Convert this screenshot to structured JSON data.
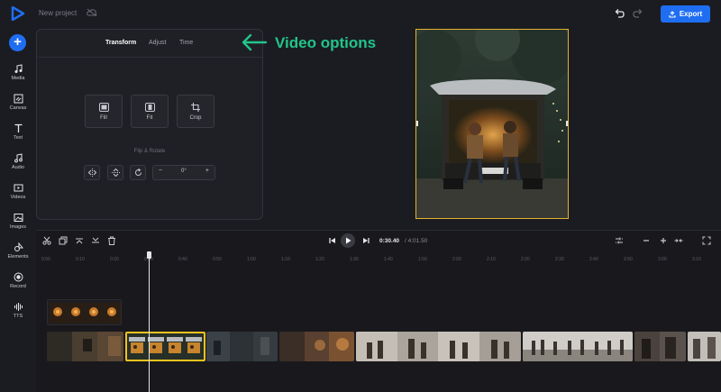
{
  "app": {
    "project_name": "New project",
    "export_label": "Export",
    "accent": "#1f6ef2",
    "logo_color": "#1f6ef2"
  },
  "sidebar": {
    "add_icon": "plus-icon",
    "items": [
      {
        "label": "Media",
        "icon": "music-note-icon"
      },
      {
        "label": "Canvas",
        "icon": "canvas-icon"
      },
      {
        "label": "Text",
        "icon": "text-icon"
      },
      {
        "label": "Audio",
        "icon": "audio-icon"
      },
      {
        "label": "Videos",
        "icon": "video-icon"
      },
      {
        "label": "Images",
        "icon": "image-icon"
      },
      {
        "label": "Elements",
        "icon": "elements-icon"
      },
      {
        "label": "Record",
        "icon": "record-icon"
      },
      {
        "label": "TTS",
        "icon": "tts-icon"
      }
    ]
  },
  "panel": {
    "tabs": [
      {
        "label": "Transform",
        "active": true
      },
      {
        "label": "Adjust",
        "active": false
      },
      {
        "label": "Time",
        "active": false
      }
    ],
    "tools": [
      {
        "label": "Fill",
        "icon": "fill-icon"
      },
      {
        "label": "Fit",
        "icon": "fit-icon"
      },
      {
        "label": "Crop",
        "icon": "crop-icon"
      }
    ],
    "flip_rotate_label": "Flip & Rotate",
    "rotation_value": "0°",
    "minus": "−",
    "plus": "+"
  },
  "annotation": {
    "text": "Video options",
    "color": "#22c48a"
  },
  "timeline": {
    "current_time": "0:30.40",
    "total_time": "/ 4:01.50",
    "ruler_ticks": [
      "0:00",
      "0:10",
      "0:20",
      "0:30",
      "0:40",
      "0:50",
      "1:00",
      "1:10",
      "1:20",
      "1:30",
      "1:40",
      "1:50",
      "2:00",
      "2:10",
      "2:20",
      "2:30",
      "2:40",
      "2:50",
      "3:00",
      "3:10"
    ],
    "selected_color": "#f2c21c"
  }
}
